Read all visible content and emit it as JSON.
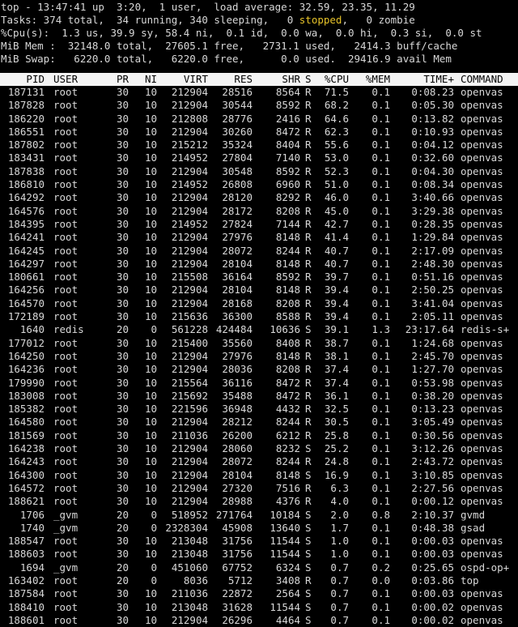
{
  "summary": {
    "line1": "top - 13:47:41 up  3:20,  1 user,  load average: 32.59, 23.35, 11.29",
    "line2_a": "Tasks: 374 total,  34 running, 340 sleeping,   0 ",
    "line2_stopped": "stopped",
    "line2_b": ",   0 zombie",
    "line3": "%Cpu(s):  1.3 us, 39.9 sy, 58.4 ni,  0.1 id,  0.0 wa,  0.0 hi,  0.3 si,  0.0 st",
    "line4": "MiB Mem :  32148.0 total,  27605.1 free,   2731.1 used,   2414.3 buff/cache",
    "line5": "MiB Swap:   6220.0 total,   6220.0 free,      0.0 used.  29416.9 avail Mem"
  },
  "columns": [
    "PID",
    "USER",
    "PR",
    "NI",
    "VIRT",
    "RES",
    "SHR",
    "S",
    "%CPU",
    "%MEM",
    "TIME+",
    "COMMAND"
  ],
  "processes": [
    [
      "187131",
      "root",
      "30",
      "10",
      "212904",
      "28516",
      "8564",
      "R",
      "71.5",
      "0.1",
      "0:08.23",
      "openvas"
    ],
    [
      "187828",
      "root",
      "30",
      "10",
      "212904",
      "30544",
      "8592",
      "R",
      "68.2",
      "0.1",
      "0:05.30",
      "openvas"
    ],
    [
      "186220",
      "root",
      "30",
      "10",
      "212808",
      "28776",
      "2416",
      "R",
      "64.6",
      "0.1",
      "0:13.82",
      "openvas"
    ],
    [
      "186551",
      "root",
      "30",
      "10",
      "212904",
      "30260",
      "8472",
      "R",
      "62.3",
      "0.1",
      "0:10.93",
      "openvas"
    ],
    [
      "187802",
      "root",
      "30",
      "10",
      "215212",
      "35324",
      "8404",
      "R",
      "55.6",
      "0.1",
      "0:04.12",
      "openvas"
    ],
    [
      "183431",
      "root",
      "30",
      "10",
      "214952",
      "27804",
      "7140",
      "R",
      "53.0",
      "0.1",
      "0:32.60",
      "openvas"
    ],
    [
      "187838",
      "root",
      "30",
      "10",
      "212904",
      "30548",
      "8592",
      "R",
      "52.3",
      "0.1",
      "0:04.30",
      "openvas"
    ],
    [
      "186810",
      "root",
      "30",
      "10",
      "214952",
      "26808",
      "6960",
      "R",
      "51.0",
      "0.1",
      "0:08.34",
      "openvas"
    ],
    [
      "164292",
      "root",
      "30",
      "10",
      "212904",
      "28120",
      "8292",
      "R",
      "46.0",
      "0.1",
      "3:40.66",
      "openvas"
    ],
    [
      "164576",
      "root",
      "30",
      "10",
      "212904",
      "28172",
      "8208",
      "R",
      "45.0",
      "0.1",
      "3:29.38",
      "openvas"
    ],
    [
      "184395",
      "root",
      "30",
      "10",
      "214952",
      "27824",
      "7144",
      "R",
      "42.7",
      "0.1",
      "0:28.35",
      "openvas"
    ],
    [
      "164241",
      "root",
      "30",
      "10",
      "212904",
      "27976",
      "8148",
      "R",
      "41.4",
      "0.1",
      "1:29.84",
      "openvas"
    ],
    [
      "164245",
      "root",
      "30",
      "10",
      "212904",
      "28072",
      "8244",
      "R",
      "40.7",
      "0.1",
      "2:17.09",
      "openvas"
    ],
    [
      "164297",
      "root",
      "30",
      "10",
      "212904",
      "28104",
      "8148",
      "R",
      "40.7",
      "0.1",
      "2:48.30",
      "openvas"
    ],
    [
      "180661",
      "root",
      "30",
      "10",
      "215508",
      "36164",
      "8592",
      "R",
      "39.7",
      "0.1",
      "0:51.16",
      "openvas"
    ],
    [
      "164256",
      "root",
      "30",
      "10",
      "212904",
      "28104",
      "8148",
      "R",
      "39.4",
      "0.1",
      "2:50.25",
      "openvas"
    ],
    [
      "164570",
      "root",
      "30",
      "10",
      "212904",
      "28168",
      "8208",
      "R",
      "39.4",
      "0.1",
      "3:41.04",
      "openvas"
    ],
    [
      "172189",
      "root",
      "30",
      "10",
      "215636",
      "36300",
      "8588",
      "R",
      "39.4",
      "0.1",
      "2:05.11",
      "openvas"
    ],
    [
      "1640",
      "redis",
      "20",
      "0",
      "561228",
      "424484",
      "10636",
      "S",
      "39.1",
      "1.3",
      "23:17.64",
      "redis-s+"
    ],
    [
      "177012",
      "root",
      "30",
      "10",
      "215400",
      "35560",
      "8408",
      "R",
      "38.7",
      "0.1",
      "1:24.68",
      "openvas"
    ],
    [
      "164250",
      "root",
      "30",
      "10",
      "212904",
      "27976",
      "8148",
      "R",
      "38.1",
      "0.1",
      "2:45.70",
      "openvas"
    ],
    [
      "164236",
      "root",
      "30",
      "10",
      "212904",
      "28036",
      "8208",
      "R",
      "37.4",
      "0.1",
      "1:27.70",
      "openvas"
    ],
    [
      "179990",
      "root",
      "30",
      "10",
      "215564",
      "36116",
      "8472",
      "R",
      "37.4",
      "0.1",
      "0:53.98",
      "openvas"
    ],
    [
      "183008",
      "root",
      "30",
      "10",
      "215692",
      "35488",
      "8472",
      "R",
      "36.1",
      "0.1",
      "0:38.20",
      "openvas"
    ],
    [
      "185382",
      "root",
      "30",
      "10",
      "221596",
      "36948",
      "4432",
      "R",
      "32.5",
      "0.1",
      "0:13.23",
      "openvas"
    ],
    [
      "164580",
      "root",
      "30",
      "10",
      "212904",
      "28212",
      "8244",
      "R",
      "30.5",
      "0.1",
      "3:05.49",
      "openvas"
    ],
    [
      "181569",
      "root",
      "30",
      "10",
      "211036",
      "26200",
      "6212",
      "R",
      "25.8",
      "0.1",
      "0:30.56",
      "openvas"
    ],
    [
      "164238",
      "root",
      "30",
      "10",
      "212904",
      "28060",
      "8232",
      "S",
      "25.2",
      "0.1",
      "3:12.26",
      "openvas"
    ],
    [
      "164243",
      "root",
      "30",
      "10",
      "212904",
      "28072",
      "8244",
      "R",
      "24.8",
      "0.1",
      "2:43.72",
      "openvas"
    ],
    [
      "164300",
      "root",
      "30",
      "10",
      "212904",
      "28104",
      "8148",
      "S",
      "16.9",
      "0.1",
      "3:10.85",
      "openvas"
    ],
    [
      "164572",
      "root",
      "30",
      "10",
      "212904",
      "27320",
      "7516",
      "R",
      "6.3",
      "0.1",
      "2:27.56",
      "openvas"
    ],
    [
      "188621",
      "root",
      "30",
      "10",
      "212904",
      "28988",
      "4376",
      "R",
      "4.0",
      "0.1",
      "0:00.12",
      "openvas"
    ],
    [
      "1706",
      "_gvm",
      "20",
      "0",
      "518952",
      "271764",
      "10184",
      "S",
      "2.0",
      "0.8",
      "2:10.37",
      "gvmd"
    ],
    [
      "1740",
      "_gvm",
      "20",
      "0",
      "2328304",
      "45908",
      "13640",
      "S",
      "1.7",
      "0.1",
      "0:48.38",
      "gsad"
    ],
    [
      "188547",
      "root",
      "30",
      "10",
      "213048",
      "31756",
      "11544",
      "S",
      "1.0",
      "0.1",
      "0:00.03",
      "openvas"
    ],
    [
      "188603",
      "root",
      "30",
      "10",
      "213048",
      "31756",
      "11544",
      "S",
      "1.0",
      "0.1",
      "0:00.03",
      "openvas"
    ],
    [
      "1694",
      "_gvm",
      "20",
      "0",
      "451060",
      "67752",
      "6324",
      "S",
      "0.7",
      "0.2",
      "0:25.65",
      "ospd-op+"
    ],
    [
      "163402",
      "root",
      "20",
      "0",
      "8036",
      "5712",
      "3408",
      "R",
      "0.7",
      "0.0",
      "0:03.86",
      "top"
    ],
    [
      "187584",
      "root",
      "30",
      "10",
      "211036",
      "22872",
      "2564",
      "S",
      "0.7",
      "0.1",
      "0:00.03",
      "openvas"
    ],
    [
      "188410",
      "root",
      "30",
      "10",
      "213048",
      "31628",
      "11544",
      "S",
      "0.7",
      "0.1",
      "0:00.02",
      "openvas"
    ],
    [
      "188601",
      "root",
      "30",
      "10",
      "212904",
      "26296",
      "4464",
      "S",
      "0.7",
      "0.1",
      "0:00.02",
      "openvas"
    ]
  ]
}
